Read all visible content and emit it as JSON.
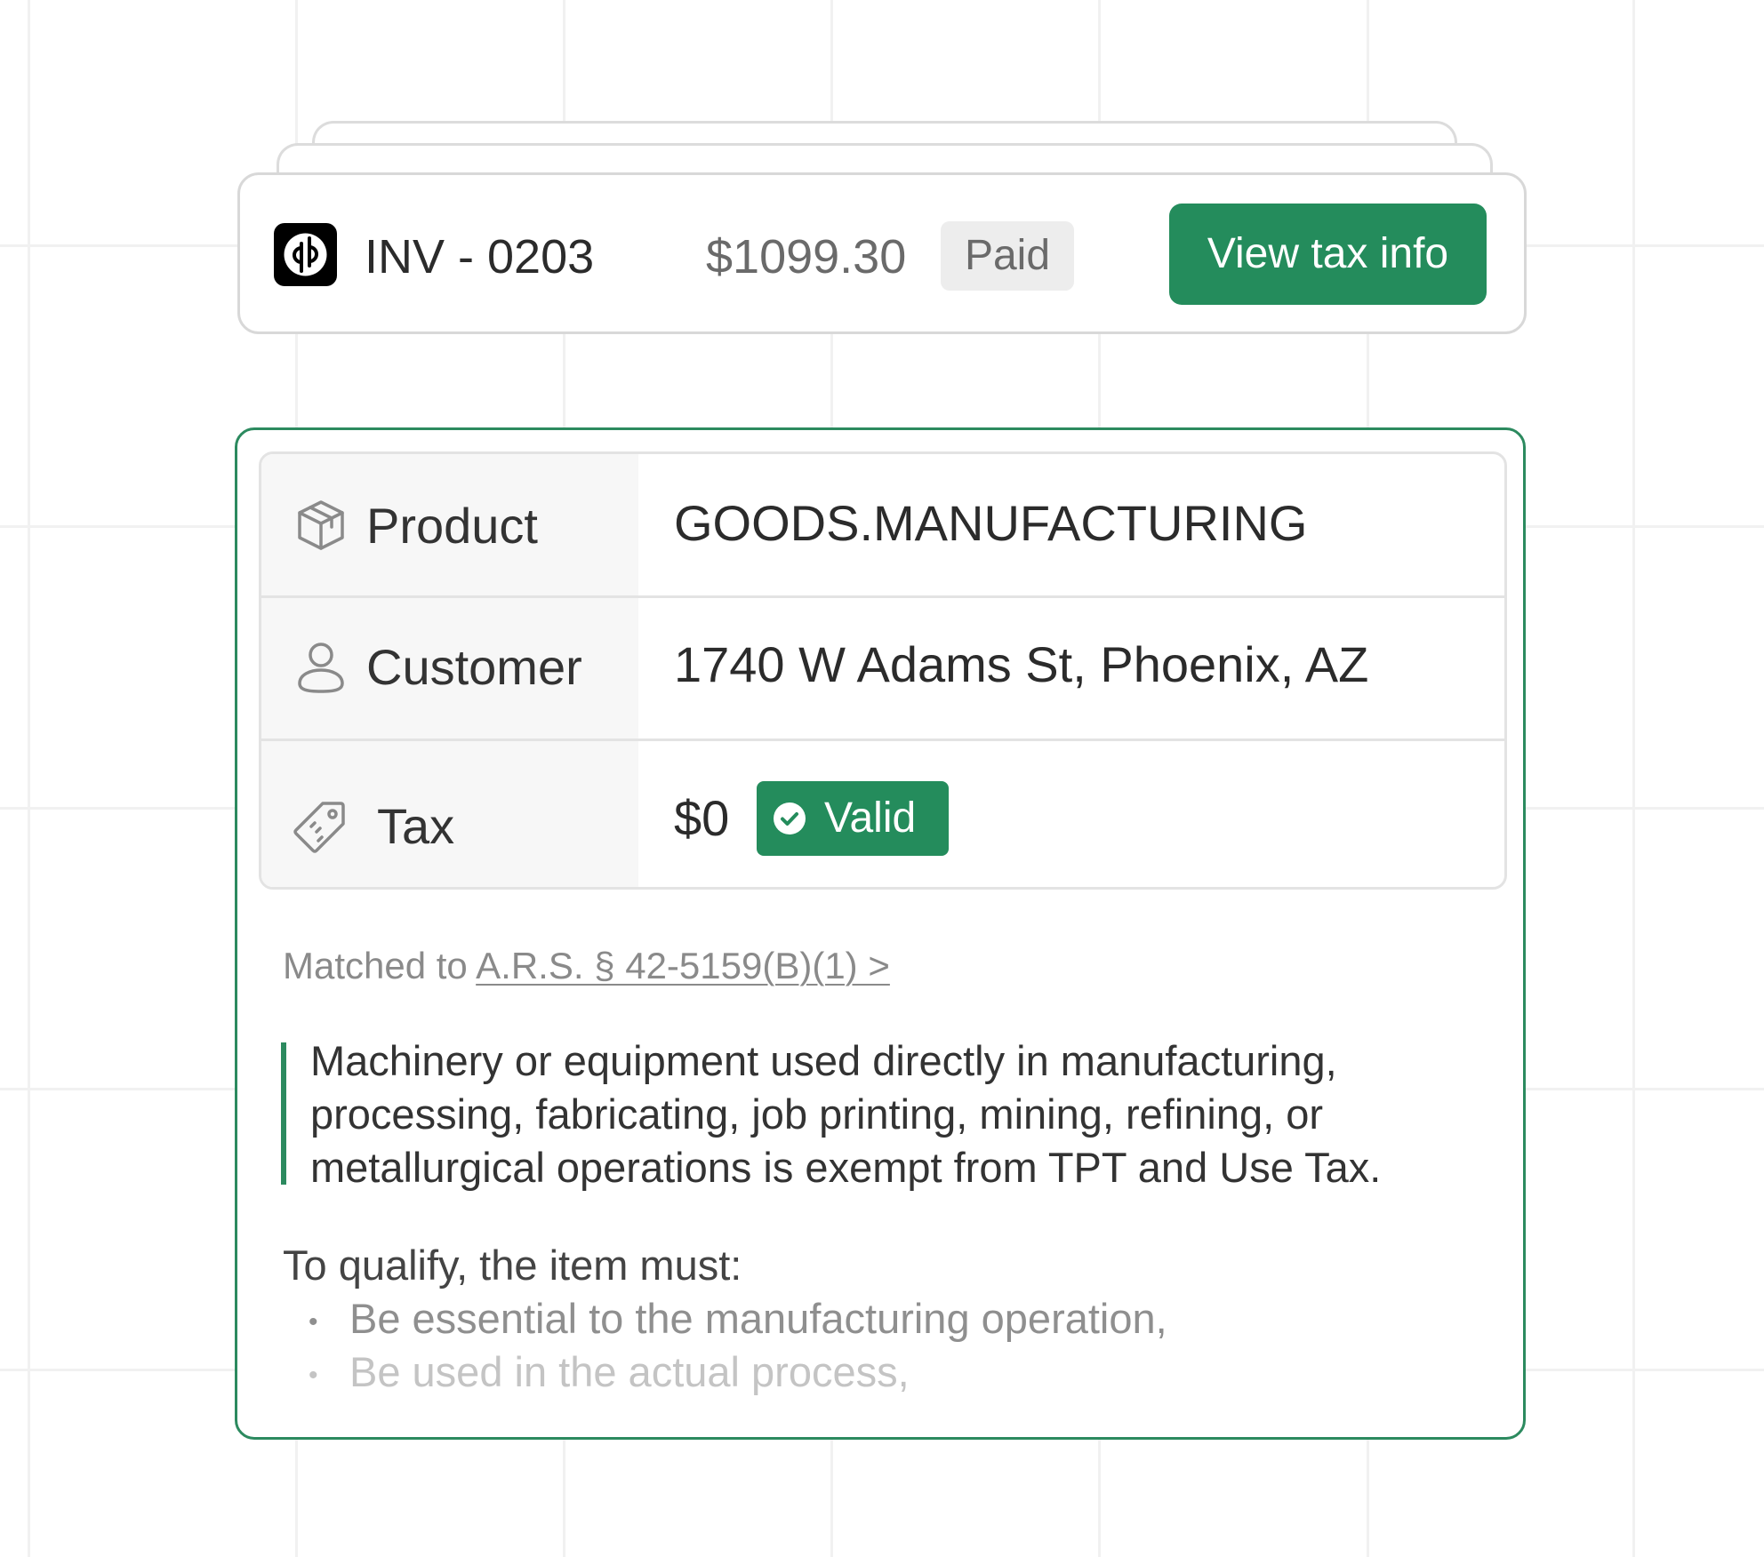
{
  "invoice": {
    "logo_icon": "quickbooks-logo-icon",
    "id": "INV - 0203",
    "amount": "$1099.30",
    "status": "Paid",
    "view_tax_button_label": "View tax info"
  },
  "tax_details": {
    "rows": [
      {
        "icon": "box-icon",
        "label": "Product",
        "value": "GOODS.MANUFACTURING"
      },
      {
        "icon": "user-icon",
        "label": "Customer",
        "value": "1740 W Adams St, Phoenix, AZ"
      },
      {
        "icon": "tag-icon",
        "label": "Tax",
        "value": "$0",
        "badge_icon": "check-circle-icon",
        "badge": "Valid"
      }
    ],
    "matched_prefix": "Matched to",
    "matched_link": "A.R.S. § 42-5159(B)(1) >",
    "quote": "Machinery or equipment used directly in manufacturing, processing, fabricating, job printing, mining, refining, or metallurgical operations is exempt from TPT and Use Tax.",
    "qualify_heading": "To qualify, the item must:",
    "criteria": [
      "Be essential to the manufacturing operation,",
      "Be used in the actual process,"
    ]
  },
  "colors": {
    "accent_green": "#248c5c",
    "panel_border": "#2c8a5f",
    "badge_gray": "#ededed"
  }
}
